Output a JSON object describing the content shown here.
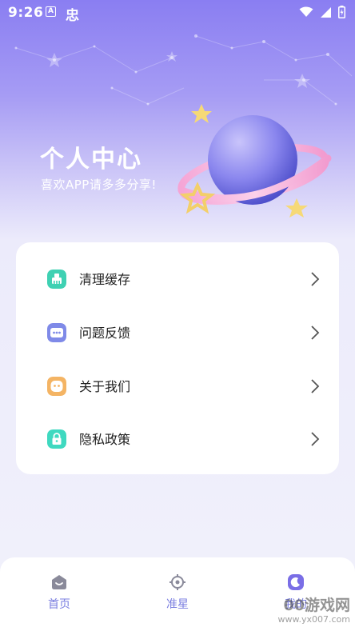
{
  "status_bar": {
    "time": "9:26",
    "a_icon_label": "A",
    "app_icon_label": "忠",
    "wifi_icon": "wifi-icon",
    "signal_icon": "signal-icon",
    "battery_icon": "battery-charging-icon"
  },
  "header": {
    "title": "个人中心",
    "subtitle": "喜欢APP请多多分享!"
  },
  "menu": {
    "items": [
      {
        "label": "清理缓存",
        "icon": "broom-icon",
        "color": "#3fd1b3"
      },
      {
        "label": "问题反馈",
        "icon": "chat-dots-icon",
        "color": "#7f8ae8"
      },
      {
        "label": "关于我们",
        "icon": "smile-icon",
        "color": "#f4b464"
      },
      {
        "label": "隐私政策",
        "icon": "lock-icon",
        "color": "#3fd9c0"
      }
    ]
  },
  "bottom_nav": {
    "items": [
      {
        "label": "首页",
        "icon": "home-icon",
        "active": false
      },
      {
        "label": "准星",
        "icon": "crosshair-icon",
        "active": false
      },
      {
        "label": "我的",
        "icon": "moon-icon",
        "active": true
      }
    ]
  },
  "watermark": {
    "brand": "00游戏网",
    "url": "www.yx007.com"
  },
  "colors": {
    "accent": "#7a7ee0",
    "header_gradient_top": "#8a7ef2",
    "background": "#f1f1fb"
  }
}
